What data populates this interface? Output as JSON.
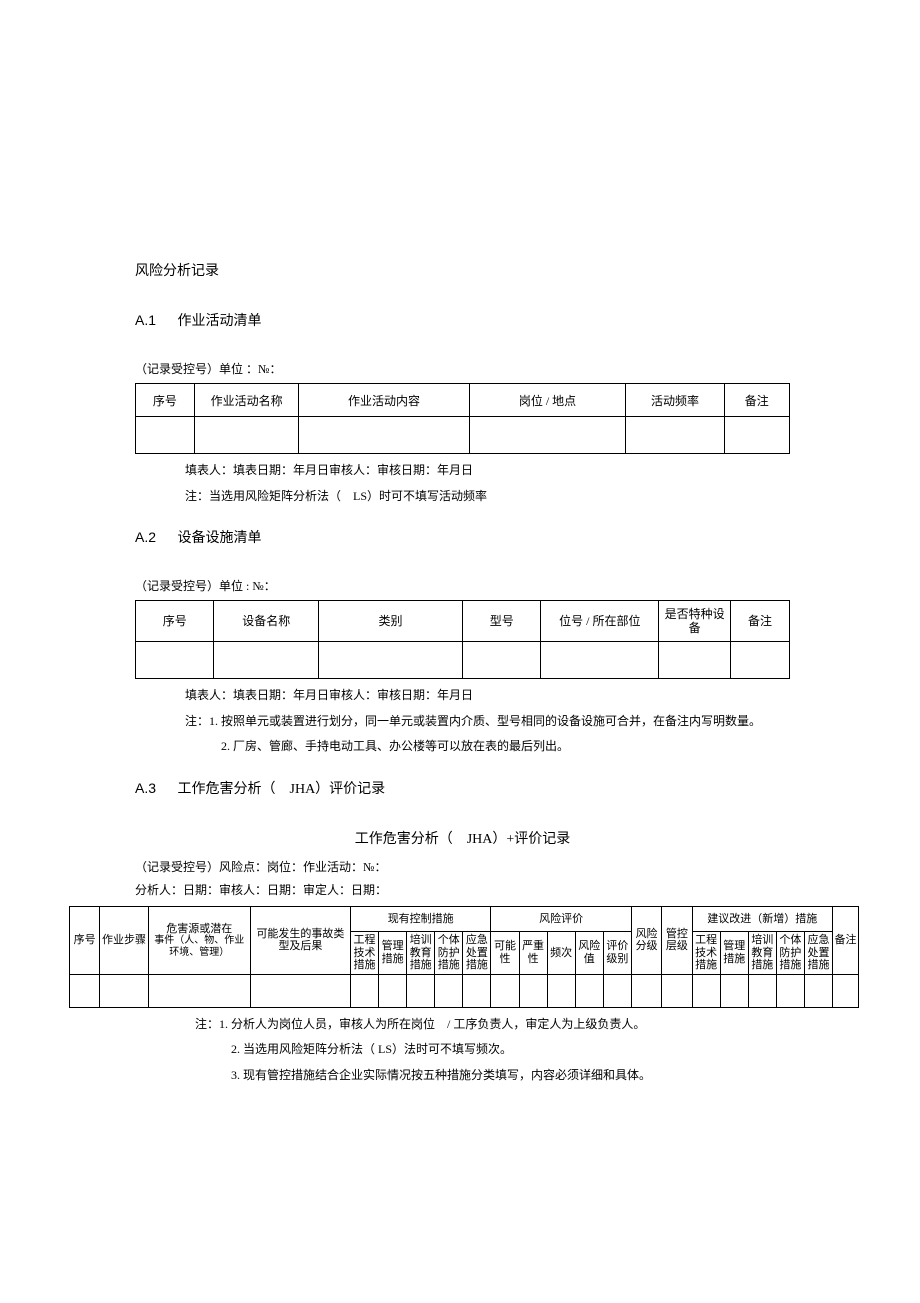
{
  "title": "风险分析记录",
  "a1": {
    "heading_num": "A.1",
    "heading_text": "作业活动清单",
    "record_line": "（记录受控号）单位 ：№：",
    "headers": [
      "序号",
      "作业活动名称",
      "作业活动内容",
      "岗位 / 地点",
      "活动频率",
      "备注"
    ],
    "footer1": "填表人：填表日期：年月日审核人：审核日期：年月日",
    "footer2": "注：当选用风险矩阵分析法（　LS）时可不填写活动频率"
  },
  "a2": {
    "heading_num": "A.2",
    "heading_text": "设备设施清单",
    "record_line": "（记录受控号）单位 : №：",
    "headers": [
      "序号",
      "设备名称",
      "类别",
      "型号",
      "位号 / 所在部位",
      "是否特种设备",
      "备注"
    ],
    "footer1": "填表人：填表日期：年月日审核人：审核日期：年月日",
    "note_label": "注：",
    "note1": "1. 按照单元或装置进行划分，同一单元或装置内介质、型号相同的设备设施可合并，在备注内写明数量。",
    "note2": "2. 厂房、管廊、手持电动工具、办公楼等可以放在表的最后列出。"
  },
  "a3": {
    "heading_num": "A.3",
    "heading_text": "工作危害分析（　JHA）评价记录",
    "center_title": "工作危害分析（　JHA）+评价记录",
    "record_line": "（记录受控号）风险点：岗位：作业活动：№：",
    "analyst_line": "分析人：日期：审核人：日期：审定人：日期：",
    "group_existing": "现有控制措施",
    "group_eval": "风险评价",
    "group_suggest": "建议改进（新增）措施",
    "h_seq": "序号",
    "h_step": "作业步骤",
    "h_hazard_main": "危害源或潜在",
    "h_hazard_sub": "事件（人、物、作业环境、管理）",
    "h_accident": "可能发生的事故类型及后果",
    "h_eng": "工程技术措施",
    "h_mgmt": "管理措施",
    "h_train": "培训教育措施",
    "h_ppe": "个体防护措施",
    "h_emerg": "应急处置措施",
    "h_poss": "可能性",
    "h_sev": "严重性",
    "h_freq": "频次",
    "h_riskval": "风险值",
    "h_evallvl": "评价级别",
    "h_risklvl": "风险分级",
    "h_ctrllvl": "管控层级",
    "h_s_eng": "工程技术措施",
    "h_s_mgmt": "管理措施",
    "h_s_train": "培训教育措施",
    "h_s_ppe": "个体防护措施",
    "h_s_emerg": "应急处置措施",
    "h_remark": "备注",
    "note_label": "注：",
    "note1": "1. 分析人为岗位人员，审核人为所在岗位　/ 工序负责人，审定人为上级负责人。",
    "note2": "2. 当选用风险矩阵分析法（ LS）法时可不填写频次。",
    "note3": "3. 现有管控措施结合企业实际情况按五种措施分类填写，内容必须详细和具体。"
  }
}
